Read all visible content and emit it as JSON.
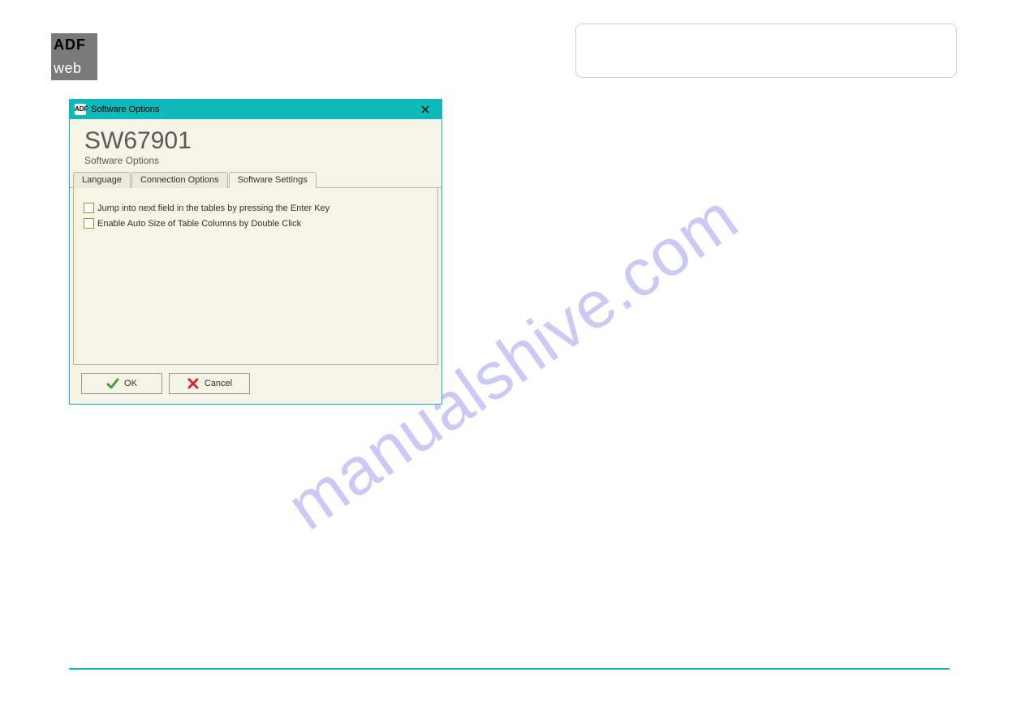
{
  "watermark": "manualshive.com",
  "logo": {
    "top": "ADF",
    "bot": "web"
  },
  "dialog": {
    "window_title": "Software Options",
    "close_label": "X",
    "header_code": "SW67901",
    "header_sub": "Software Options",
    "tabs": {
      "language": "Language",
      "connection": "Connection Options",
      "software": "Software Settings"
    },
    "settings": {
      "jump_next": "Jump into next field in the tables by pressing the Enter Key",
      "auto_size": "Enable Auto Size of Table Columns by Double Click"
    },
    "buttons": {
      "ok": "OK",
      "cancel": "Cancel"
    }
  }
}
